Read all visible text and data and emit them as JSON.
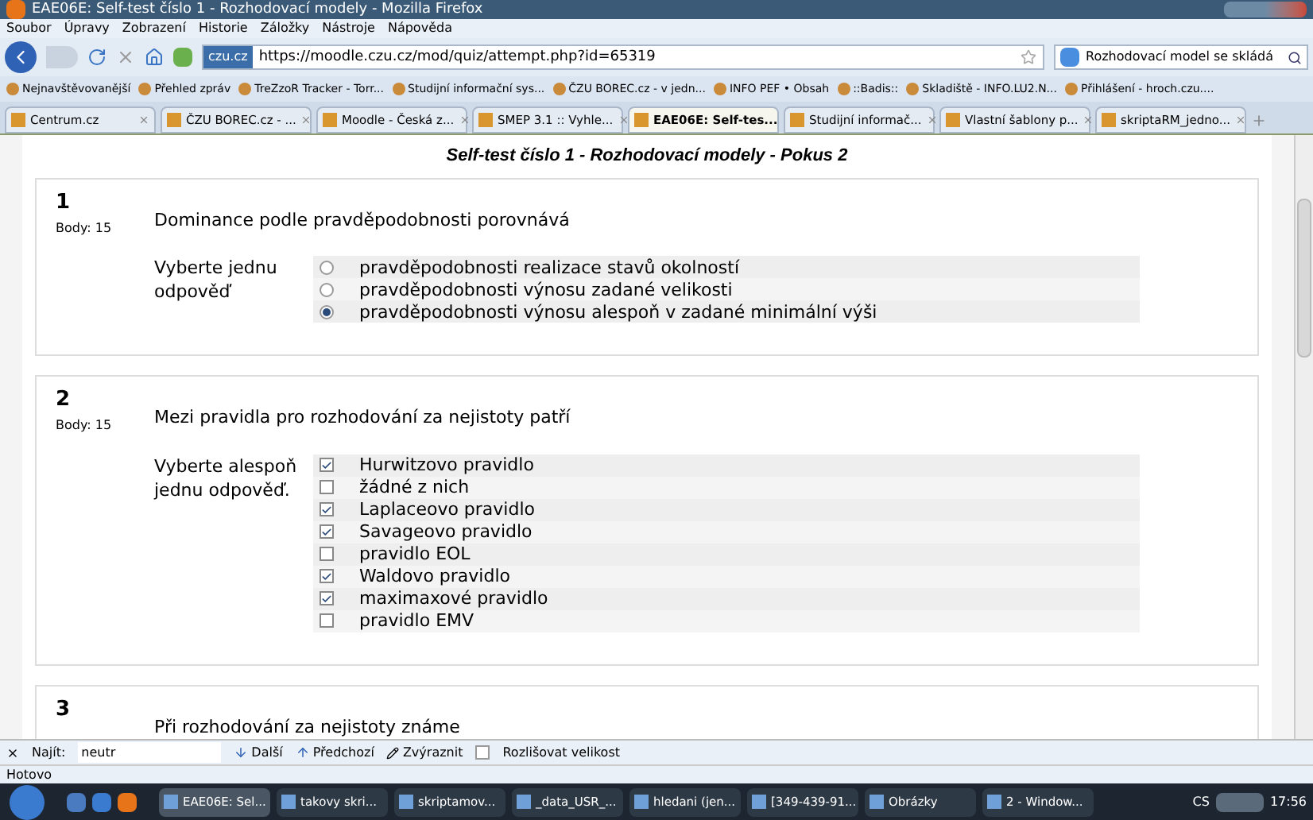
{
  "window": {
    "title": "EAE06E: Self-test číslo 1 - Rozhodovací modely - Mozilla Firefox"
  },
  "menu": [
    "Soubor",
    "Úpravy",
    "Zobrazení",
    "Historie",
    "Záložky",
    "Nástroje",
    "Nápověda"
  ],
  "address": {
    "site": "czu.cz",
    "url": "https://moodle.czu.cz/mod/quiz/attempt.php?id=65319"
  },
  "search": {
    "value": "Rozhodovací model se skládá"
  },
  "bookmarks": [
    "Nejnavštěvovanější",
    "Přehled zpráv",
    "TreZzoR Tracker - Torr...",
    "Studijní informační sys...",
    "ČZU BOREC.cz - v jedn...",
    "INFO PEF • Obsah",
    "::Badis::",
    "Skladiště - INFO.LU2.N...",
    "Přihlášení - hroch.czu...."
  ],
  "tabs": [
    {
      "label": "Centrum.cz",
      "selected": false
    },
    {
      "label": "ČZU BOREC.cz - ...",
      "selected": false
    },
    {
      "label": "Moodle - Česká z...",
      "selected": false
    },
    {
      "label": "SMEP 3.1 :: Vyhle...",
      "selected": false
    },
    {
      "label": "EAE06E: Self-tes...",
      "selected": true
    },
    {
      "label": "Studijní informač...",
      "selected": false
    },
    {
      "label": "Vlastní šablony p...",
      "selected": false
    },
    {
      "label": "skriptaRM_jedno...",
      "selected": false
    }
  ],
  "quiz_title": "Self-test číslo 1 - Rozhodovací modely - Pokus 2",
  "questions": [
    {
      "number": "1",
      "points": "Body: 15",
      "text": "Dominance podle pravděpodobnosti porovnává",
      "instruction": "Vyberte jednu odpověď",
      "kind": "radio",
      "options": [
        {
          "label": "pravděpodobnosti realizace stavů okolností",
          "selected": false
        },
        {
          "label": "pravděpodobnosti výnosu zadané velikosti",
          "selected": false
        },
        {
          "label": "pravděpodobnosti výnosu alespoň v zadané minimální výši",
          "selected": true
        }
      ]
    },
    {
      "number": "2",
      "points": "Body: 15",
      "text": "Mezi pravidla pro rozhodování za nejistoty patří",
      "instruction": "Vyberte alespoň jednu odpověď.",
      "kind": "checkbox",
      "options": [
        {
          "label": "Hurwitzovo pravidlo",
          "selected": true
        },
        {
          "label": "žádné z nich",
          "selected": false
        },
        {
          "label": "Laplaceovo pravidlo",
          "selected": true
        },
        {
          "label": "Savageovo pravidlo",
          "selected": true
        },
        {
          "label": "pravidlo EOL",
          "selected": false
        },
        {
          "label": "Waldovo pravidlo",
          "selected": true
        },
        {
          "label": "maximaxové pravidlo",
          "selected": true
        },
        {
          "label": "pravidlo EMV",
          "selected": false
        }
      ]
    },
    {
      "number": "3",
      "text": "Při rozhodování za nejistoty známe",
      "kind": "partial"
    }
  ],
  "find_bar": {
    "label": "Najít:",
    "value": "neutr",
    "next": "Další",
    "previous": "Předchozí",
    "highlight": "Zvýraznit",
    "match_case": {
      "label": "Rozlišovat velikost",
      "checked": false
    }
  },
  "status_bar": "Hotovo",
  "taskbar": {
    "items": [
      {
        "label": "EAE06E: Sel...",
        "selected": true
      },
      {
        "label": "takovy skri...",
        "selected": false
      },
      {
        "label": "skriptamov...",
        "selected": false
      },
      {
        "label": "_data_USR_...",
        "selected": false
      },
      {
        "label": "hledani (jen...",
        "selected": false
      },
      {
        "label": "[349-439-91...",
        "selected": false
      },
      {
        "label": "Obrázky",
        "selected": false
      },
      {
        "label": "2 - Window...",
        "selected": false
      }
    ],
    "language": "CS",
    "time": "17:56"
  }
}
